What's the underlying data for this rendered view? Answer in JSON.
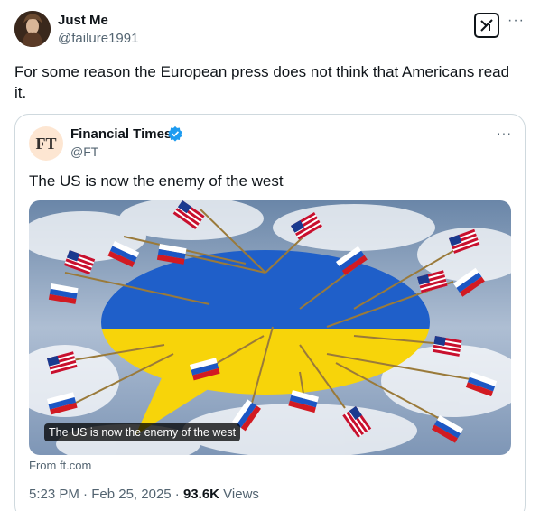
{
  "author": {
    "name": "Just Me",
    "handle": "@failure1991"
  },
  "tweet": {
    "text": "For some reason the European press does not think that Americans read it."
  },
  "header_icons": {
    "grok": "grok-icon",
    "more": "more-icon"
  },
  "quote": {
    "name": "Financial Times",
    "handle": "@FT",
    "avatar_text": "FT",
    "text": "The US is now the enemy of the west",
    "media_caption": "The US is now the enemy of the west",
    "from": "From ft.com",
    "time": "5:23 PM",
    "date": "Feb 25, 2025",
    "views_count": "93.6K",
    "views_label": "Views"
  },
  "colors": {
    "ukraine_blue": "#1f5fc9",
    "ukraine_yellow": "#f7d40a",
    "verified_blue": "#1d9bf0"
  }
}
